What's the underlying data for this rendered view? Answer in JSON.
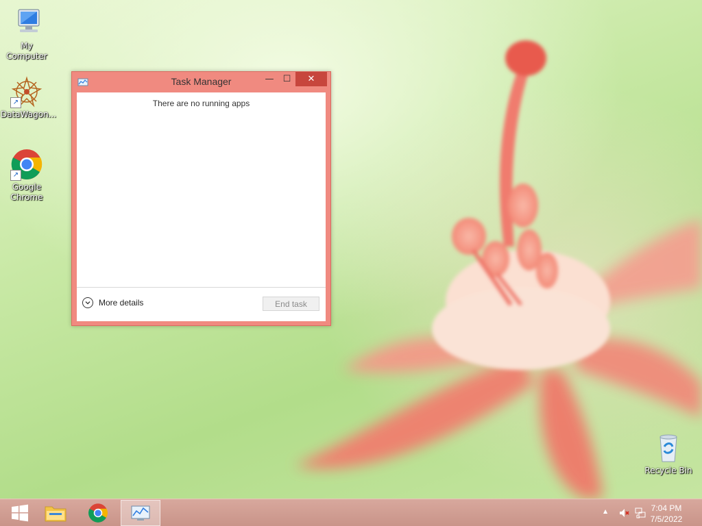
{
  "desktop": {
    "icons": [
      {
        "label": "My Computer",
        "icon": "my-computer-icon"
      },
      {
        "label": "DataWagon...",
        "icon": "datawagon-icon"
      },
      {
        "label": "Google Chrome",
        "icon": "chrome-icon"
      },
      {
        "label": "Recycle Bin",
        "icon": "recycle-bin-icon"
      }
    ]
  },
  "task_manager": {
    "title": "Task Manager",
    "minimize": "—",
    "maximize": "☐",
    "close": "✕",
    "empty_message": "There are no running apps",
    "more_details": "More details",
    "end_task": "End task"
  },
  "taskbar": {
    "items": [
      "start-button",
      "file-explorer",
      "google-chrome",
      "task-manager"
    ],
    "clock": {
      "time": "7:04 PM",
      "date": "7/5/2022"
    },
    "tray": [
      "show-hidden-icons-arrow",
      "volume-muted-icon",
      "network-icon"
    ],
    "tray_arrow": "▲"
  },
  "colors": {
    "window_frame": "#f08a80",
    "close_button": "#c7463d",
    "taskbar": "#d0a096"
  }
}
